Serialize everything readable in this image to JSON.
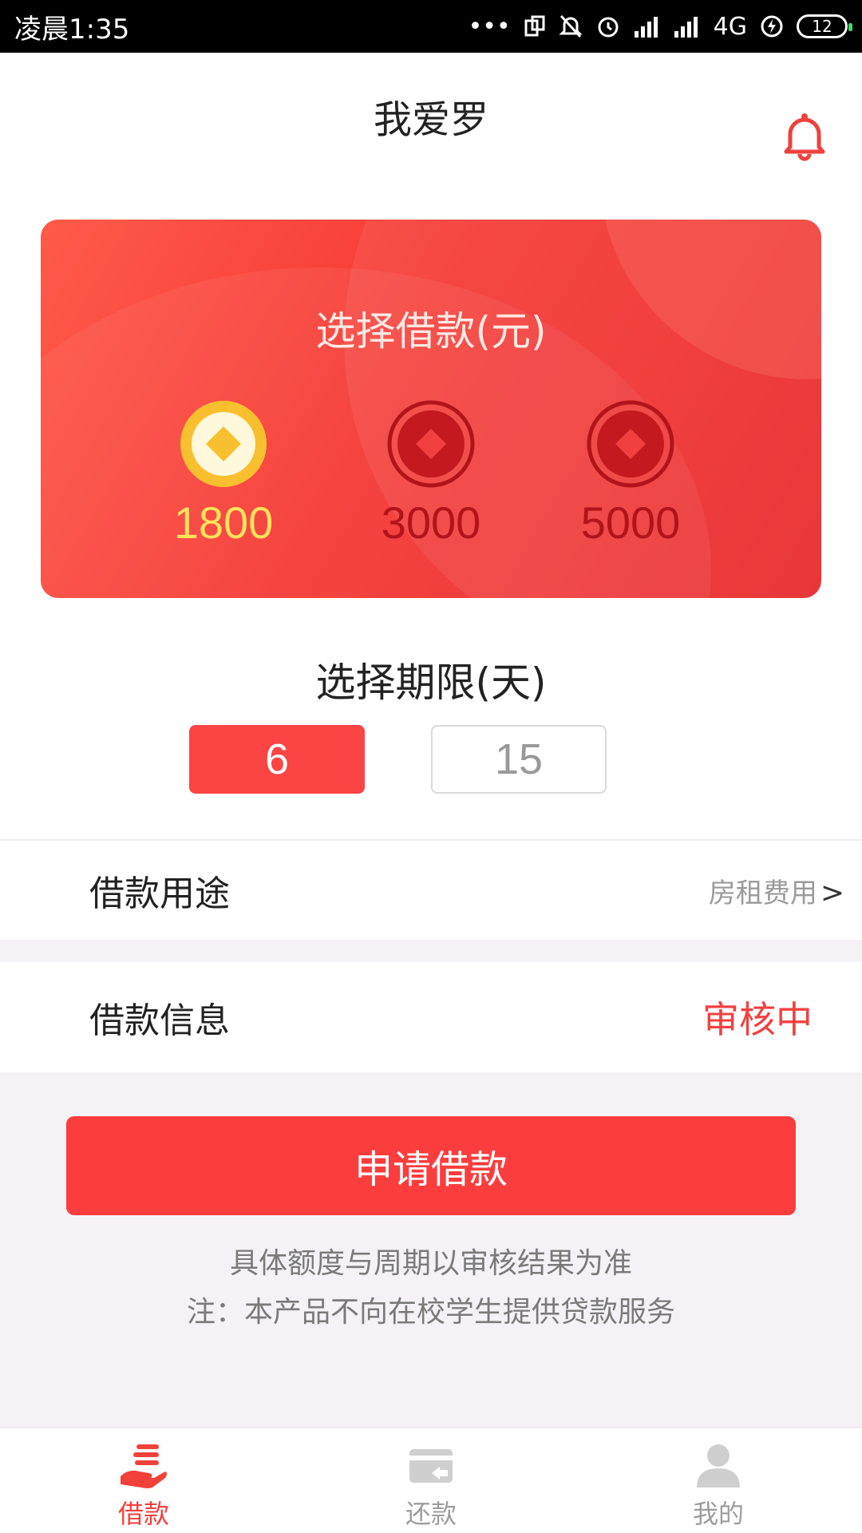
{
  "status_bar": {
    "time": "凌晨1:35",
    "network": "4G",
    "battery": "12"
  },
  "header": {
    "title": "我爱罗"
  },
  "amount_card": {
    "title": "选择借款(元)",
    "options": [
      {
        "label": "1800",
        "selected": true
      },
      {
        "label": "3000",
        "selected": false
      },
      {
        "label": "5000",
        "selected": false
      }
    ]
  },
  "period": {
    "title": "选择期限(天)",
    "options": [
      {
        "label": "6",
        "selected": true
      },
      {
        "label": "15",
        "selected": false
      }
    ]
  },
  "purpose": {
    "label": "借款用途",
    "value": "房租费用",
    "arrow": ">"
  },
  "info": {
    "label": "借款信息",
    "value": "审核中"
  },
  "apply_button": "申请借款",
  "notes": {
    "line1": "具体额度与周期以审核结果为准",
    "line2": "注：本产品不向在校学生提供贷款服务"
  },
  "tabs": [
    {
      "label": "借款",
      "icon": "loan-hand-icon",
      "active": true
    },
    {
      "label": "还款",
      "icon": "repay-card-icon",
      "active": false
    },
    {
      "label": "我的",
      "icon": "user-icon",
      "active": false
    }
  ],
  "colors": {
    "accent": "#fc3d3d",
    "selected_amount": "#ffe25c",
    "unselected_amount": "#b3131a",
    "status_value": "#f24040"
  }
}
